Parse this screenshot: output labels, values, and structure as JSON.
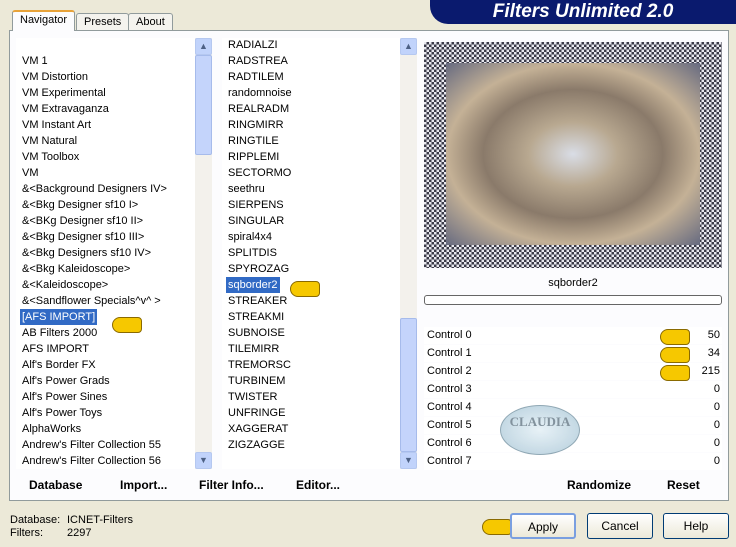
{
  "title": "Filters Unlimited 2.0",
  "tabs": [
    {
      "label": "Navigator"
    },
    {
      "label": "Presets"
    },
    {
      "label": "About"
    }
  ],
  "categories": [
    "VM 1",
    "VM Distortion",
    "VM Experimental",
    "VM Extravaganza",
    "VM Instant Art",
    "VM Natural",
    "VM Toolbox",
    "VM",
    "&<Background Designers IV>",
    "&<Bkg Designer sf10 I>",
    "&<BKg Designer sf10 II>",
    "&<Bkg Designer sf10 III>",
    "&<Bkg Designers sf10 IV>",
    "&<Bkg Kaleidoscope>",
    "&<Kaleidoscope>",
    "&<Sandflower Specials^v^ >",
    "[AFS IMPORT]",
    "AB Filters 2000",
    "AFS IMPORT",
    "Alf's Border FX",
    "Alf's Power Grads",
    "Alf's Power Sines",
    "Alf's Power Toys",
    "AlphaWorks",
    "Andrew's Filter Collection 55",
    "Andrew's Filter Collection 56"
  ],
  "selected_category": "[AFS IMPORT]",
  "filters": [
    "RADIALZI",
    "RADSTREA",
    "RADTILEM",
    "randomnoise",
    "REALRADM",
    "RINGMIRR",
    "RINGTILE",
    "RIPPLEMI",
    "SECTORMO",
    "seethru",
    "SIERPENS",
    "SINGULAR",
    "spiral4x4",
    "SPLITDIS",
    "SPYROZAG",
    "sqborder2",
    "STREAKER",
    "STREAKMI",
    "SUBNOISE",
    "TILEMIRR",
    "TREMORSC",
    "TURBINEM",
    "TWISTER",
    "UNFRINGE",
    "XAGGERAT",
    "ZIGZAGGE"
  ],
  "selected_filter": "sqborder2",
  "filter_name": "sqborder2",
  "controls": [
    {
      "label": "Control 0",
      "value": "50"
    },
    {
      "label": "Control 1",
      "value": "34"
    },
    {
      "label": "Control 2",
      "value": "215"
    },
    {
      "label": "Control 3",
      "value": "0"
    },
    {
      "label": "Control 4",
      "value": "0"
    },
    {
      "label": "Control 5",
      "value": "0"
    },
    {
      "label": "Control 6",
      "value": "0"
    },
    {
      "label": "Control 7",
      "value": "0"
    }
  ],
  "bottom": {
    "database": "Database",
    "import": "Import...",
    "filter_info": "Filter Info...",
    "editor": "Editor...",
    "randomize": "Randomize",
    "reset": "Reset"
  },
  "status": {
    "database_label": "Database:",
    "database_value": "ICNET-Filters",
    "filters_label": "Filters:",
    "filters_value": "2297"
  },
  "buttons": {
    "apply": "Apply",
    "cancel": "Cancel",
    "help": "Help"
  },
  "watermark": "CLAUDIA"
}
